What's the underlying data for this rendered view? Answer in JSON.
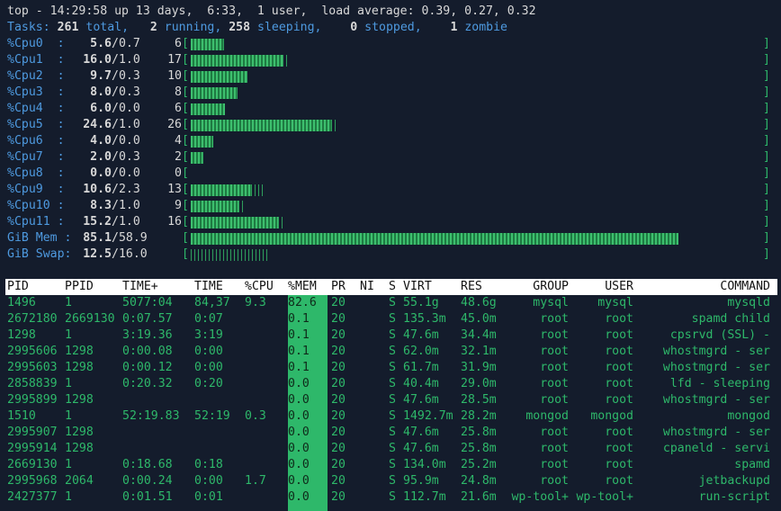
{
  "summary": {
    "line1": "top - 14:29:58 up 13 days,  6:33,  1 user,  load average: 0.39, 0.27, 0.32",
    "tasks": {
      "label": "Tasks:",
      "total": "261",
      "total_label": "total,",
      "running": "2",
      "running_label": "running,",
      "sleeping": "258",
      "sleeping_label": "sleeping,",
      "stopped": "0",
      "stopped_label": "stopped,",
      "zombie": "1",
      "zombie_label": "zombie"
    }
  },
  "cpus": [
    {
      "label": "%Cpu0  :",
      "user": "5.6",
      "sys": "/0.7",
      "total": "6",
      "user_frac": 0.056,
      "sys_frac": 0.007
    },
    {
      "label": "%Cpu1  :",
      "user": "16.0",
      "sys": "/1.0",
      "total": "17",
      "user_frac": 0.16,
      "sys_frac": 0.01
    },
    {
      "label": "%Cpu2  :",
      "user": "9.7",
      "sys": "/0.3",
      "total": "10",
      "user_frac": 0.097,
      "sys_frac": 0.003
    },
    {
      "label": "%Cpu3  :",
      "user": "8.0",
      "sys": "/0.3",
      "total": "8",
      "user_frac": 0.08,
      "sys_frac": 0.003
    },
    {
      "label": "%Cpu4  :",
      "user": "6.0",
      "sys": "/0.0",
      "total": "6",
      "user_frac": 0.06,
      "sys_frac": 0.0
    },
    {
      "label": "%Cpu5  :",
      "user": "24.6",
      "sys": "/1.0",
      "total": "26",
      "user_frac": 0.246,
      "sys_frac": 0.01
    },
    {
      "label": "%Cpu6  :",
      "user": "4.0",
      "sys": "/0.0",
      "total": "4",
      "user_frac": 0.04,
      "sys_frac": 0.0
    },
    {
      "label": "%Cpu7  :",
      "user": "2.0",
      "sys": "/0.3",
      "total": "2",
      "user_frac": 0.02,
      "sys_frac": 0.003
    },
    {
      "label": "%Cpu8  :",
      "user": "0.0",
      "sys": "/0.0",
      "total": "0",
      "user_frac": 0.0,
      "sys_frac": 0.0
    },
    {
      "label": "%Cpu9  :",
      "user": "10.6",
      "sys": "/2.3",
      "total": "13",
      "user_frac": 0.106,
      "sys_frac": 0.023
    },
    {
      "label": "%Cpu10 :",
      "user": "8.3",
      "sys": "/1.0",
      "total": "9",
      "user_frac": 0.083,
      "sys_frac": 0.01
    },
    {
      "label": "%Cpu11 :",
      "user": "15.2",
      "sys": "/1.0",
      "total": "16",
      "user_frac": 0.152,
      "sys_frac": 0.01
    }
  ],
  "mem": {
    "label": "GiB Mem :",
    "used": "85.1",
    "total": "/58.9",
    "used_frac": 0.86
  },
  "swap": {
    "label": "GiB Swap:",
    "used": "12.5",
    "total": "/16.0",
    "used_frac": 0.14
  },
  "columns": [
    "PID",
    "PPID",
    "TIME+",
    "TIME",
    "%CPU",
    "%MEM",
    "PR",
    "NI",
    "S",
    "VIRT",
    "RES",
    "GROUP",
    "USER",
    "COMMAND"
  ],
  "processes": [
    {
      "pid": "1496",
      "ppid": "1",
      "timeplus": "5077:04",
      "time": "84,37",
      "cpu": "9.3",
      "mem": "82.6",
      "pr": "20",
      "ni": "",
      "s": "S",
      "virt": "55.1g",
      "res": "48.6g",
      "group": "mysql",
      "user": "mysql",
      "command": "mysqld"
    },
    {
      "pid": "2672180",
      "ppid": "2669130",
      "timeplus": "0:07.57",
      "time": "0:07",
      "cpu": "",
      "mem": "0.1",
      "pr": "20",
      "ni": "",
      "s": "S",
      "virt": "135.3m",
      "res": "45.0m",
      "group": "root",
      "user": "root",
      "command": "spamd child"
    },
    {
      "pid": "1298",
      "ppid": "1",
      "timeplus": "3:19.36",
      "time": "3:19",
      "cpu": "",
      "mem": "0.1",
      "pr": "20",
      "ni": "",
      "s": "S",
      "virt": "47.6m",
      "res": "34.4m",
      "group": "root",
      "user": "root",
      "command": "cpsrvd (SSL) -"
    },
    {
      "pid": "2995606",
      "ppid": "1298",
      "timeplus": "0:00.08",
      "time": "0:00",
      "cpu": "",
      "mem": "0.1",
      "pr": "20",
      "ni": "",
      "s": "S",
      "virt": "62.0m",
      "res": "32.1m",
      "group": "root",
      "user": "root",
      "command": "whostmgrd - ser"
    },
    {
      "pid": "2995603",
      "ppid": "1298",
      "timeplus": "0:00.12",
      "time": "0:00",
      "cpu": "",
      "mem": "0.1",
      "pr": "20",
      "ni": "",
      "s": "S",
      "virt": "61.7m",
      "res": "31.9m",
      "group": "root",
      "user": "root",
      "command": "whostmgrd - ser"
    },
    {
      "pid": "2858839",
      "ppid": "1",
      "timeplus": "0:20.32",
      "time": "0:20",
      "cpu": "",
      "mem": "0.0",
      "pr": "20",
      "ni": "",
      "s": "S",
      "virt": "40.4m",
      "res": "29.0m",
      "group": "root",
      "user": "root",
      "command": "lfd - sleeping"
    },
    {
      "pid": "2995899",
      "ppid": "1298",
      "timeplus": "",
      "time": "",
      "cpu": "",
      "mem": "0.0",
      "pr": "20",
      "ni": "",
      "s": "S",
      "virt": "47.6m",
      "res": "28.5m",
      "group": "root",
      "user": "root",
      "command": "whostmgrd - ser"
    },
    {
      "pid": "1510",
      "ppid": "1",
      "timeplus": "52:19.83",
      "time": "52:19",
      "cpu": "0.3",
      "mem": "0.0",
      "pr": "20",
      "ni": "",
      "s": "S",
      "virt": "1492.7m",
      "res": "28.2m",
      "group": "mongod",
      "user": "mongod",
      "command": "mongod"
    },
    {
      "pid": "2995907",
      "ppid": "1298",
      "timeplus": "",
      "time": "",
      "cpu": "",
      "mem": "0.0",
      "pr": "20",
      "ni": "",
      "s": "S",
      "virt": "47.6m",
      "res": "25.8m",
      "group": "root",
      "user": "root",
      "command": "whostmgrd - ser"
    },
    {
      "pid": "2995914",
      "ppid": "1298",
      "timeplus": "",
      "time": "",
      "cpu": "",
      "mem": "0.0",
      "pr": "20",
      "ni": "",
      "s": "S",
      "virt": "47.6m",
      "res": "25.8m",
      "group": "root",
      "user": "root",
      "command": "cpaneld - servi"
    },
    {
      "pid": "2669130",
      "ppid": "1",
      "timeplus": "0:18.68",
      "time": "0:18",
      "cpu": "",
      "mem": "0.0",
      "pr": "20",
      "ni": "",
      "s": "S",
      "virt": "134.0m",
      "res": "25.2m",
      "group": "root",
      "user": "root",
      "command": "spamd"
    },
    {
      "pid": "2995968",
      "ppid": "2064",
      "timeplus": "0:00.24",
      "time": "0:00",
      "cpu": "1.7",
      "mem": "0.0",
      "pr": "20",
      "ni": "",
      "s": "S",
      "virt": "95.9m",
      "res": "24.8m",
      "group": "root",
      "user": "root",
      "command": "jetbackupd"
    },
    {
      "pid": "2427377",
      "ppid": "1",
      "timeplus": "0:01.51",
      "time": "0:01",
      "cpu": "",
      "mem": "0.0",
      "pr": "20",
      "ni": "",
      "s": "S",
      "virt": "112.7m",
      "res": "21.6m",
      "group": "wp-tool+",
      "user": "wp-tool+",
      "command": "run-script"
    }
  ],
  "colors": {
    "background": "#141c2c",
    "accent_green": "#2eb86a",
    "header_bg": "#ffffff",
    "tasks_blue": "#4e9ae0"
  }
}
